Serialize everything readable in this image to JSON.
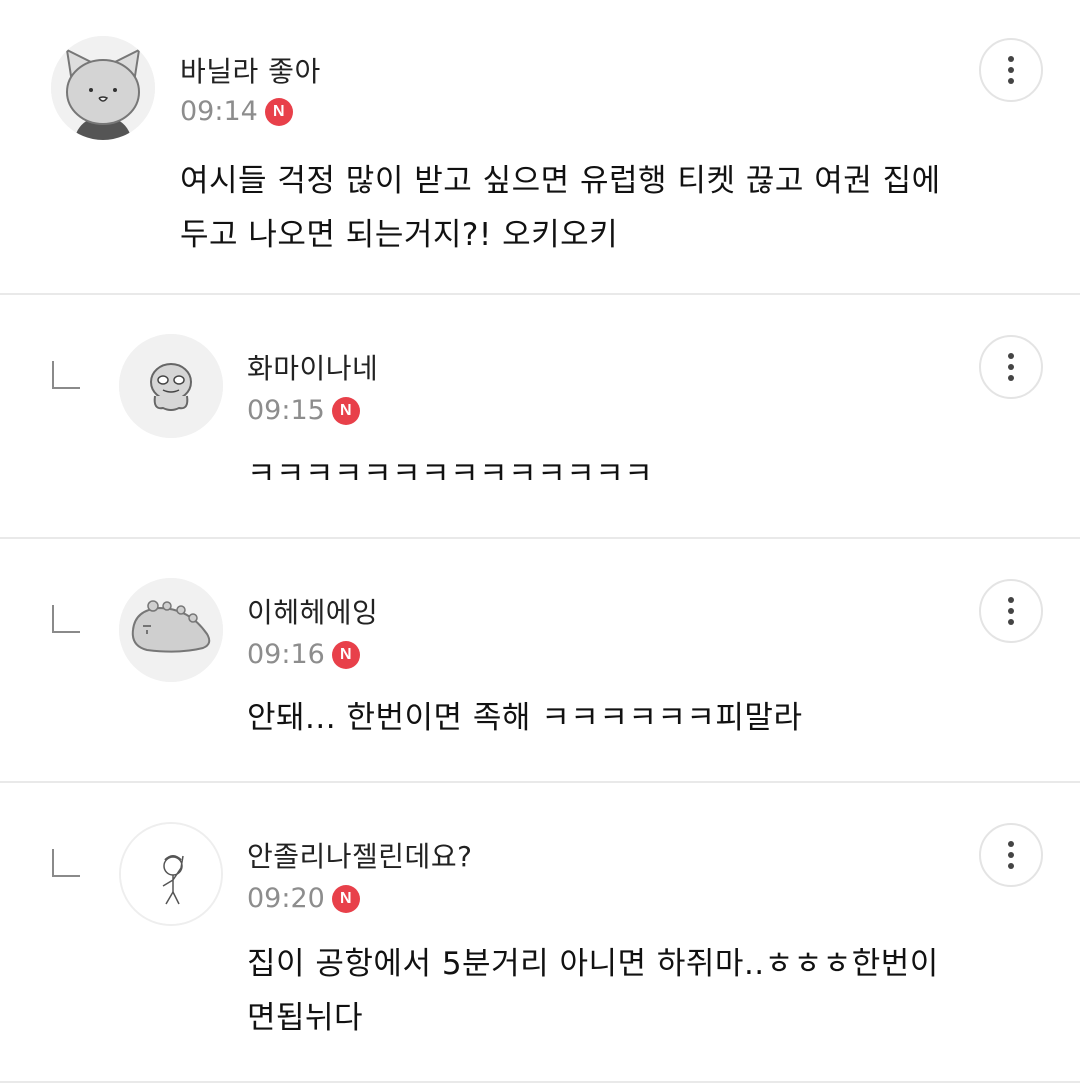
{
  "comments": [
    {
      "nickname": "바닐라 좋아",
      "time": "09:14",
      "badge": "N",
      "text": "여시들 걱정 많이 받고 싶으면 유럽행 티켓 끊고 여권 집에 두고 나오면 되는거지?! 오키오키",
      "reply": false,
      "avatar_icon": "cat-avatar-icon"
    },
    {
      "nickname": "화마이나네",
      "time": "09:15",
      "badge": "N",
      "text": "ㅋㅋㅋㅋㅋㅋㅋㅋㅋㅋㅋㅋㅋㅋ",
      "reply": true,
      "avatar_icon": "character-avatar-icon"
    },
    {
      "nickname": "이헤헤에잉",
      "time": "09:16",
      "badge": "N",
      "text": "안돼... 한번이면 족해 ㅋㅋㅋㅋㅋㅋ피말라",
      "reply": true,
      "avatar_icon": "dinosaur-avatar-icon"
    },
    {
      "nickname": "안졸리나젤린데요?",
      "time": "09:20",
      "badge": "N",
      "text": "집이 공항에서 5분거리 아니면 하쥐마..ㅎㅎㅎ한번이면됩뉘다",
      "reply": true,
      "avatar_icon": "boy-avatar-icon"
    }
  ],
  "colors": {
    "badge": "#e8404a",
    "divider": "#e9e9e9",
    "time": "#8d8d8d"
  }
}
